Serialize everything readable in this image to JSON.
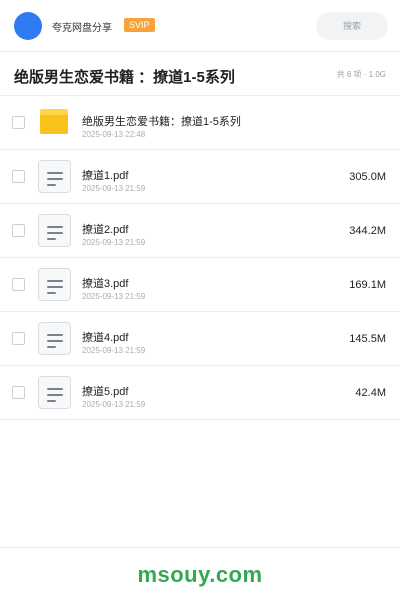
{
  "header": {
    "app_title": "夸克网盘分享",
    "badge": "SVIP",
    "search_placeholder": "搜索"
  },
  "folder": {
    "title": "绝版男生恋爱书籍 ：撩道1-5系列",
    "summary": "共 6 项 · 1.0G"
  },
  "files": [
    {
      "type": "folder",
      "name": "绝版男生恋爱书籍：撩道1-5系列",
      "date": "2025-09-13 22:48",
      "size": ""
    },
    {
      "type": "pdf",
      "name": "撩道1.pdf",
      "date": "2025-09-13 21:59",
      "size": "305.0M"
    },
    {
      "type": "pdf",
      "name": "撩道2.pdf",
      "date": "2025-09-13 21:59",
      "size": "344.2M"
    },
    {
      "type": "pdf",
      "name": "撩道3.pdf",
      "date": "2025-09-13 21:59",
      "size": "169.1M"
    },
    {
      "type": "pdf",
      "name": "撩道4.pdf",
      "date": "2025-09-13 21:59",
      "size": "145.5M"
    },
    {
      "type": "pdf",
      "name": "撩道5.pdf",
      "date": "2025-09-13 21:59",
      "size": "42.4M"
    }
  ],
  "watermark": "msouy.com",
  "colors": {
    "accent": "#2f7bf2",
    "badge": "#f6a33a",
    "folder": "#f8c21a",
    "watermark": "#34a853"
  }
}
